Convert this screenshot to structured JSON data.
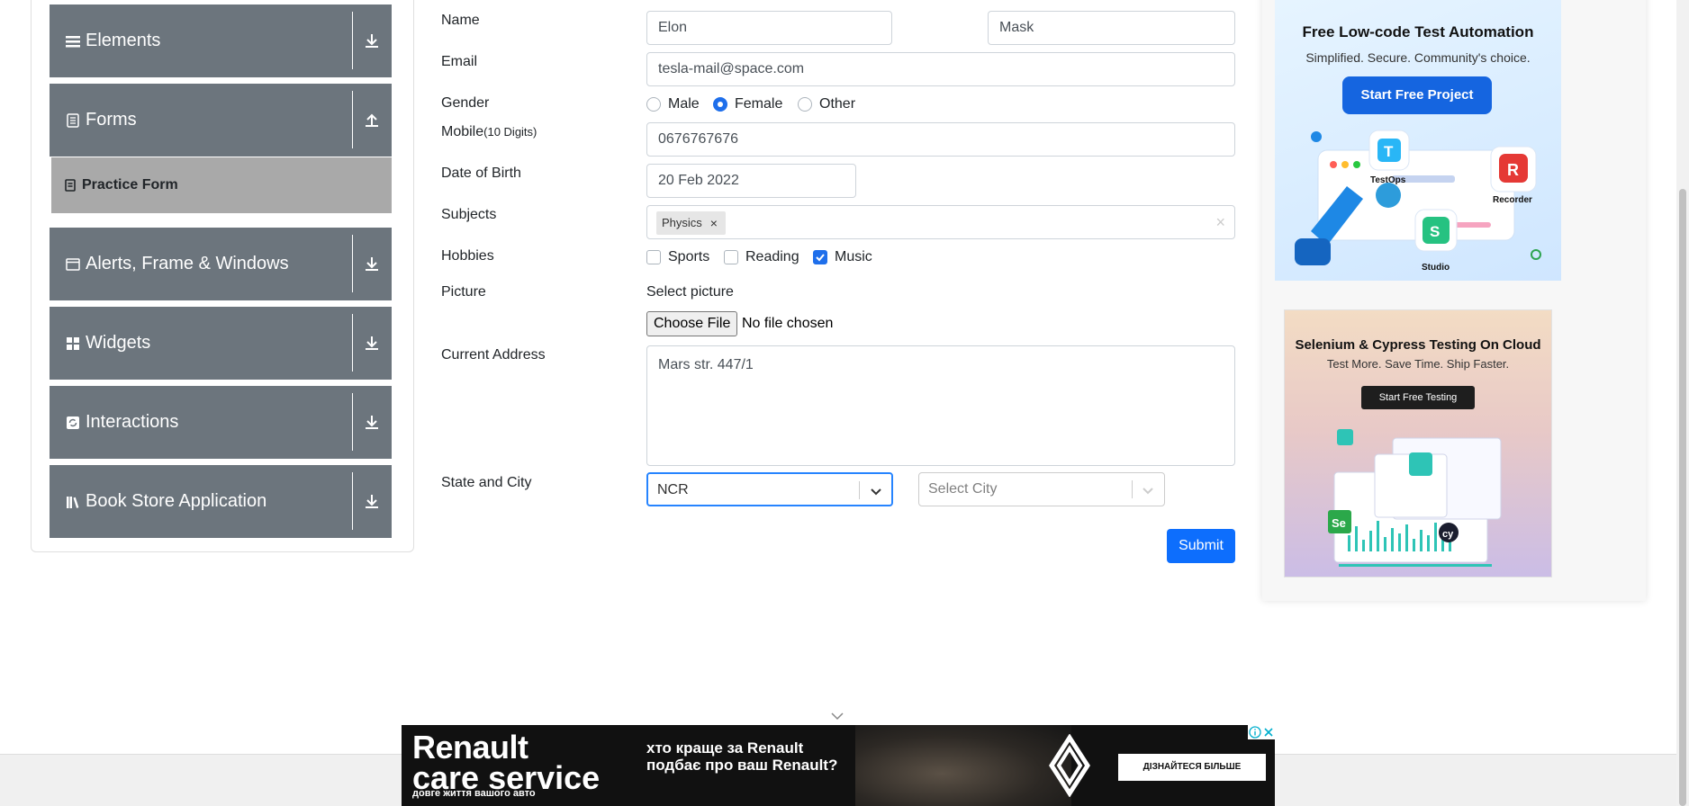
{
  "sidebar": {
    "groups": [
      {
        "label": "Elements",
        "icon": "menu-icon",
        "toggle": "download-icon"
      },
      {
        "label": "Forms",
        "icon": "document-icon",
        "toggle": "upload-icon"
      },
      {
        "label": "Alerts, Frame & Windows",
        "icon": "window-icon",
        "toggle": "download-icon"
      },
      {
        "label": "Widgets",
        "icon": "widgets-icon",
        "toggle": "download-icon"
      },
      {
        "label": "Interactions",
        "icon": "refresh-icon",
        "toggle": "download-icon"
      },
      {
        "label": "Book Store Application",
        "icon": "books-icon",
        "toggle": "download-icon"
      }
    ],
    "active_item": {
      "label": "Practice Form",
      "icon": "form-icon"
    }
  },
  "form": {
    "name_label": "Name",
    "first_name": "Elon",
    "last_name": "Mask",
    "email_label": "Email",
    "email": "tesla-mail@space.com",
    "gender_label": "Gender",
    "gender_options": [
      "Male",
      "Female",
      "Other"
    ],
    "gender_selected": "Female",
    "mobile_label": "Mobile",
    "mobile_hint": "(10 Digits)",
    "mobile": "0676767676",
    "dob_label": "Date of Birth",
    "dob": "20 Feb 2022",
    "subjects_label": "Subjects",
    "subjects": [
      "Physics"
    ],
    "subject_remove": "×",
    "subjects_clear": "×",
    "hobbies_label": "Hobbies",
    "hobbies": [
      "Sports",
      "Reading",
      "Music"
    ],
    "hobbies_checked": [
      "Music"
    ],
    "picture_label": "Picture",
    "picture_select": "Select picture",
    "choose_file": "Choose File",
    "no_file": "No file chosen",
    "address_label": "Current Address",
    "address": "Mars str. 447/1",
    "state_city_label": "State and City",
    "state": "NCR",
    "city_placeholder": "Select City",
    "submit": "Submit"
  },
  "ads": {
    "ad1": {
      "title": "Free Low-code Test Automation",
      "subtitle": "Simplified. Secure. Community's choice.",
      "button": "Start Free Project",
      "labels": [
        "TestOps",
        "Recorder",
        "Studio"
      ]
    },
    "ad2": {
      "title": "Selenium & Cypress Testing On Cloud",
      "subtitle": "Test More. Save Time. Ship Faster.",
      "button": "Start Free Testing"
    },
    "banner": {
      "line1": "Renault",
      "line2": "care service",
      "tagline": "довге життя вашого авто",
      "question": "хто краще за Renault подбає про ваш Renault?",
      "cta": "ДІЗНАЙТЕСЯ БІЛЬШЕ"
    }
  },
  "colors": {
    "sidebar_group": "#6c757d",
    "sidebar_active": "#a9a9a9",
    "primary": "#0d6efd",
    "focus_border": "#2684ff"
  }
}
